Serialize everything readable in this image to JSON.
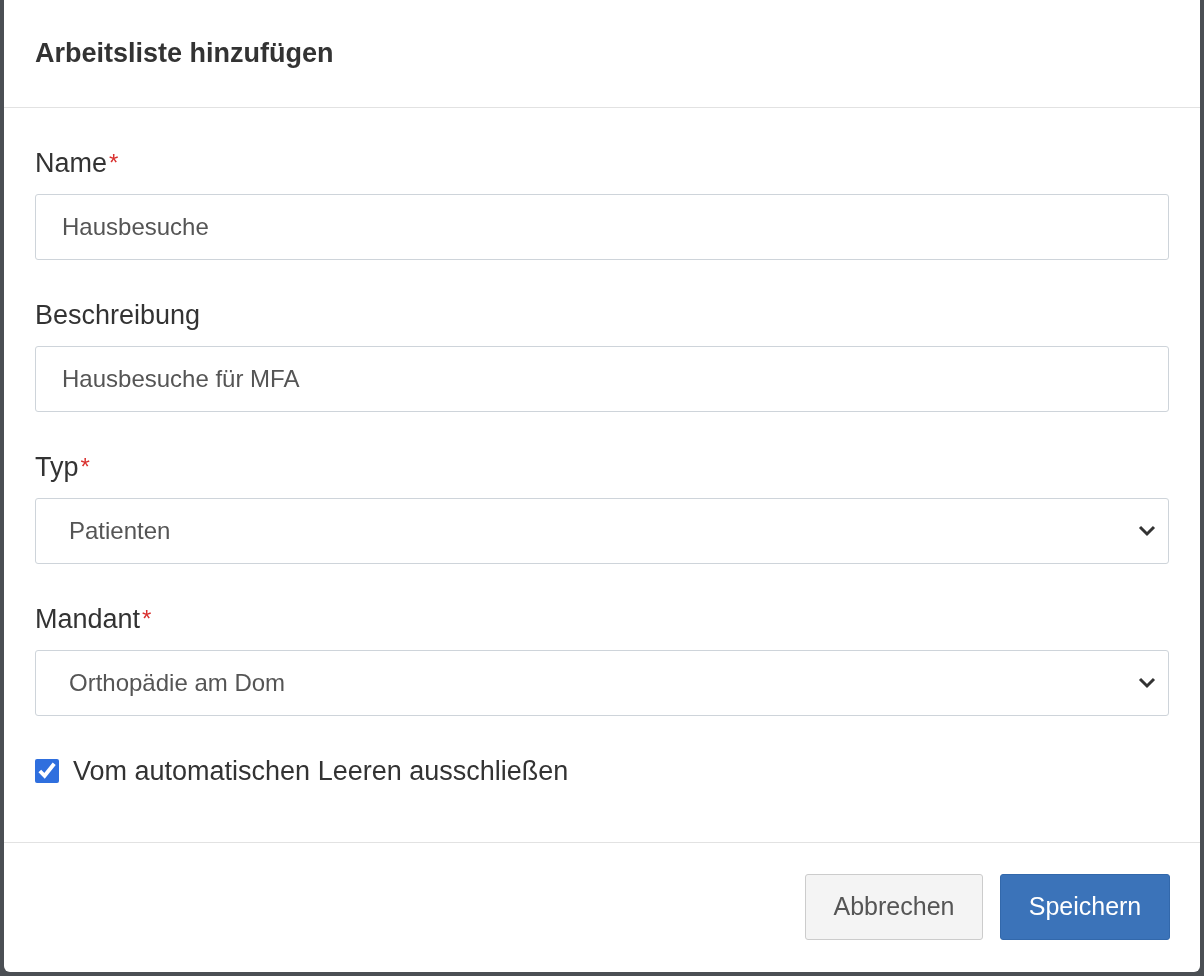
{
  "dialog": {
    "title": "Arbeitsliste hinzufügen"
  },
  "fields": [
    {
      "kind": "text",
      "label": "Name",
      "required_mark": "*",
      "value": "Hausbesuche"
    },
    {
      "kind": "text",
      "label": "Beschreibung",
      "value": "Hausbesuche für MFA"
    },
    {
      "kind": "select",
      "label": "Typ",
      "required_mark": "*",
      "value": "Patienten"
    },
    {
      "kind": "select",
      "label": "Mandant",
      "required_mark": "*",
      "value": "Orthopädie am Dom"
    }
  ],
  "checkbox": {
    "label": "Vom automatischen Leeren ausschließen",
    "checked": true
  },
  "buttons": [
    {
      "kind": "secondary",
      "label": "Abbrechen"
    },
    {
      "kind": "primary",
      "label": "Speichern"
    }
  ]
}
